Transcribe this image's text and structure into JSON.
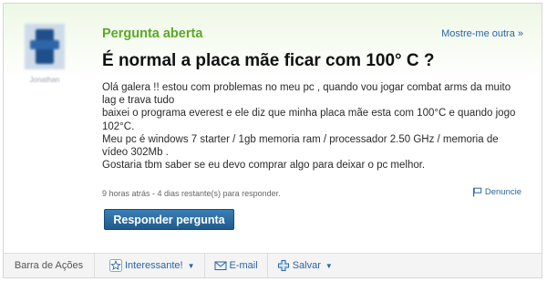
{
  "status_label": "Pergunta aberta",
  "more_link": "Mostre-me outra »",
  "question_title": "É normal a placa mãe ficar com 100° C ?",
  "body_lines": [
    "Olá galera !! estou com problemas no meu pc , quando vou jogar combat arms da muito lag e trava tudo",
    "baixei o programa everest e ele diz que minha placa mãe esta com 100°C e quando jogo 102°C.",
    "Meu pc é windows 7 starter / 1gb memoria ram / processador 2.50 GHz / memoria de vídeo 302Mb .",
    "Gostaria tbm saber se eu devo comprar algo para deixar o pc melhor."
  ],
  "meta": "9 horas atrás - 4 dias restante(s) para responder.",
  "report_label": "Denuncie",
  "answer_button": "Responder pergunta",
  "user": {
    "name": "Jonathan"
  },
  "actions": {
    "label": "Barra de Ações",
    "interesting": "Interessante!",
    "email": "E-mail",
    "save": "Salvar"
  },
  "colors": {
    "status_green": "#5ba829",
    "link_blue": "#2b65a5",
    "button_blue": "#1f5b8c"
  }
}
